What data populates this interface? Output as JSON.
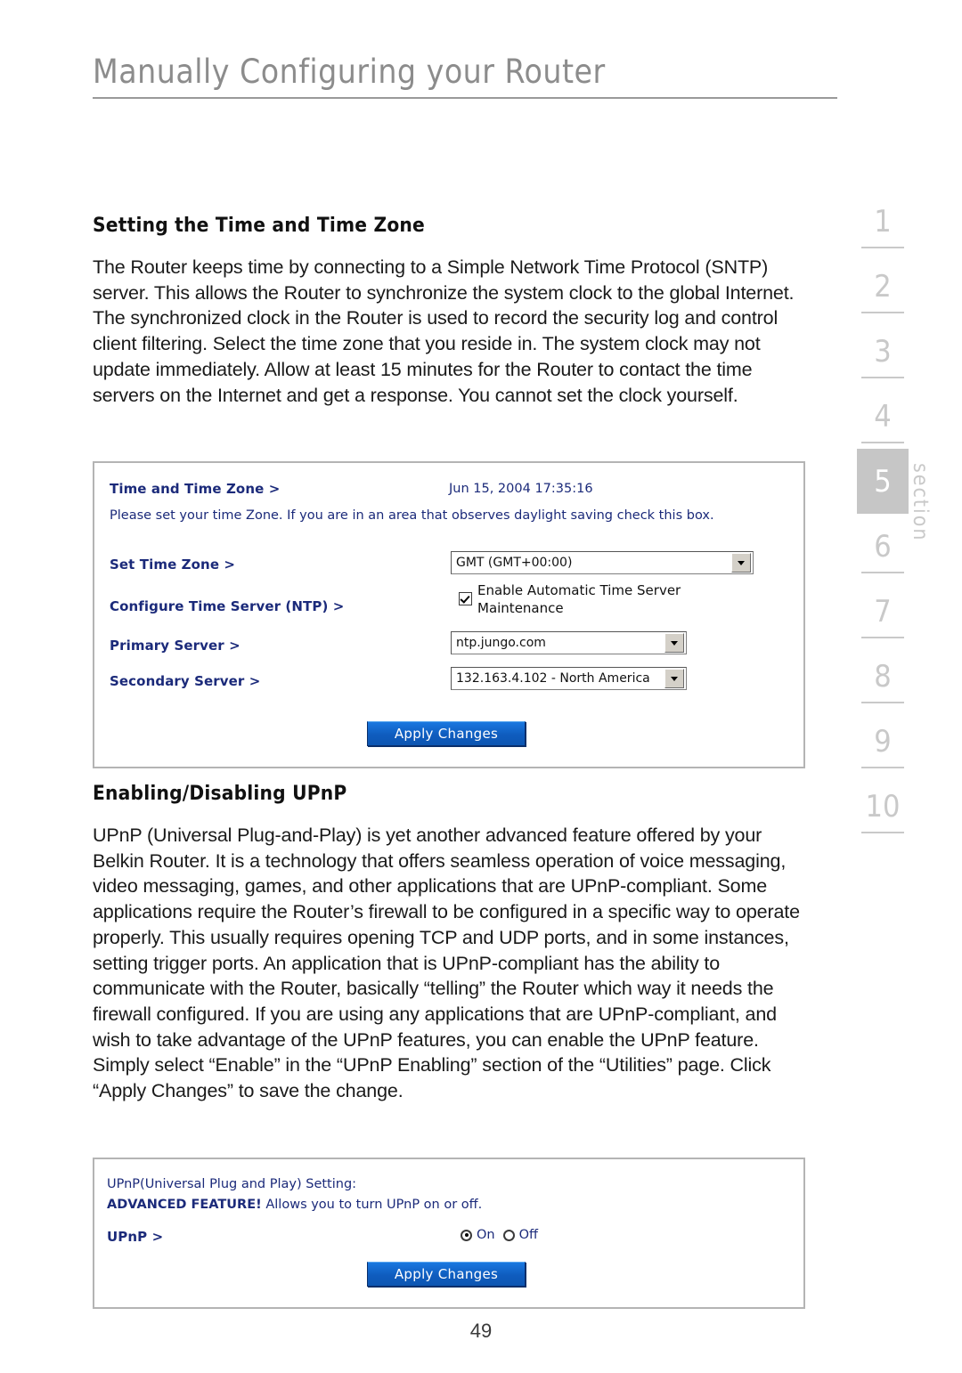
{
  "header": {
    "title": "Manually Configuring your Router"
  },
  "sections": {
    "time": {
      "heading": "Setting the Time and Time Zone",
      "paragraph": "The Router keeps time by connecting to a Simple Network Time Protocol (SNTP) server. This allows the Router to synchronize the system clock to the global Internet. The synchronized clock in the Router is used to record the security log and control client filtering. Select the time zone that you reside in. The system clock may not update immediately. Allow at least 15 minutes for the Router to contact the time servers on the Internet and get a response. You cannot set the clock yourself."
    },
    "upnp": {
      "heading": "Enabling/Disabling UPnP",
      "paragraph": "UPnP (Universal Plug-and-Play) is yet another advanced feature offered by your Belkin Router. It is a technology that offers seamless operation of voice messaging, video messaging, games, and other applications that are UPnP-compliant. Some applications require the Router’s firewall to be configured in a specific way to operate properly. This usually requires opening TCP and UDP ports, and in some instances, setting trigger ports. An application that is UPnP-compliant has the ability to communicate with the Router, basically “telling” the Router which way it needs the firewall configured. If you are using any applications that are UPnP-compliant, and wish to take advantage of the UPnP features, you can enable the UPnP feature. Simply select “Enable” in the “UPnP Enabling” section of the “Utilities” page. Click “Apply Changes” to save the change."
    }
  },
  "time_panel": {
    "title": "Time and Time Zone >",
    "timestamp": "Jun 15, 2004 17:35:16",
    "description": "Please set your time Zone. If you are in an area that observes daylight saving check this box.",
    "set_time_zone_label": "Set Time Zone >",
    "time_zone_value": "GMT (GMT+00:00)",
    "configure_ntp_label": "Configure Time Server (NTP) >",
    "auto_maintenance_label": "Enable Automatic Time Server Maintenance",
    "auto_maintenance_checked": true,
    "primary_server_label": "Primary Server >",
    "primary_server_value": "ntp.jungo.com",
    "secondary_server_label": "Secondary Server >",
    "secondary_server_value": "132.163.4.102 - North America",
    "apply_button": "Apply Changes"
  },
  "upnp_panel": {
    "title": "UPnP(Universal Plug and Play) Setting:",
    "advanced_prefix": "ADVANCED FEATURE!",
    "advanced_text": " Allows you to turn UPnP on or off.",
    "upnp_label": "UPnP >",
    "options": [
      {
        "label": "On",
        "selected": true
      },
      {
        "label": "Off",
        "selected": false
      }
    ],
    "apply_button": "Apply Changes"
  },
  "section_rail": {
    "word": "section",
    "items": [
      {
        "number": "1",
        "active": false
      },
      {
        "number": "2",
        "active": false
      },
      {
        "number": "3",
        "active": false
      },
      {
        "number": "4",
        "active": false
      },
      {
        "number": "5",
        "active": true
      },
      {
        "number": "6",
        "active": false
      },
      {
        "number": "7",
        "active": false
      },
      {
        "number": "8",
        "active": false
      },
      {
        "number": "9",
        "active": false
      },
      {
        "number": "10",
        "active": false
      }
    ]
  },
  "footer": {
    "page_number": "49"
  },
  "colors": {
    "label_blue": "#1b2a7a",
    "button_blue": "#1464c8",
    "rail_gray": "#c9c9c9",
    "header_gray": "#8c8c8c"
  }
}
